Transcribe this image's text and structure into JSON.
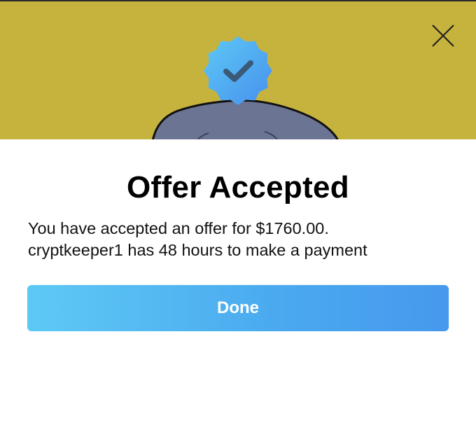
{
  "dialog": {
    "title": "Offer Accepted",
    "message_line1": "You have accepted an offer for $1760.00.",
    "message_line2": "cryptkeeper1 has 48 hours to make a payment",
    "done_label": "Done"
  },
  "icons": {
    "close": "close-icon",
    "badge": "verified-badge-icon"
  },
  "colors": {
    "hero_background": "#c6b33e",
    "badge_gradient_start": "#5ec9f5",
    "badge_gradient_end": "#4690ee",
    "button_gradient_start": "#5ec9f5",
    "button_gradient_end": "#4699ee",
    "button_text": "#ffffff",
    "title_text": "#000000"
  }
}
